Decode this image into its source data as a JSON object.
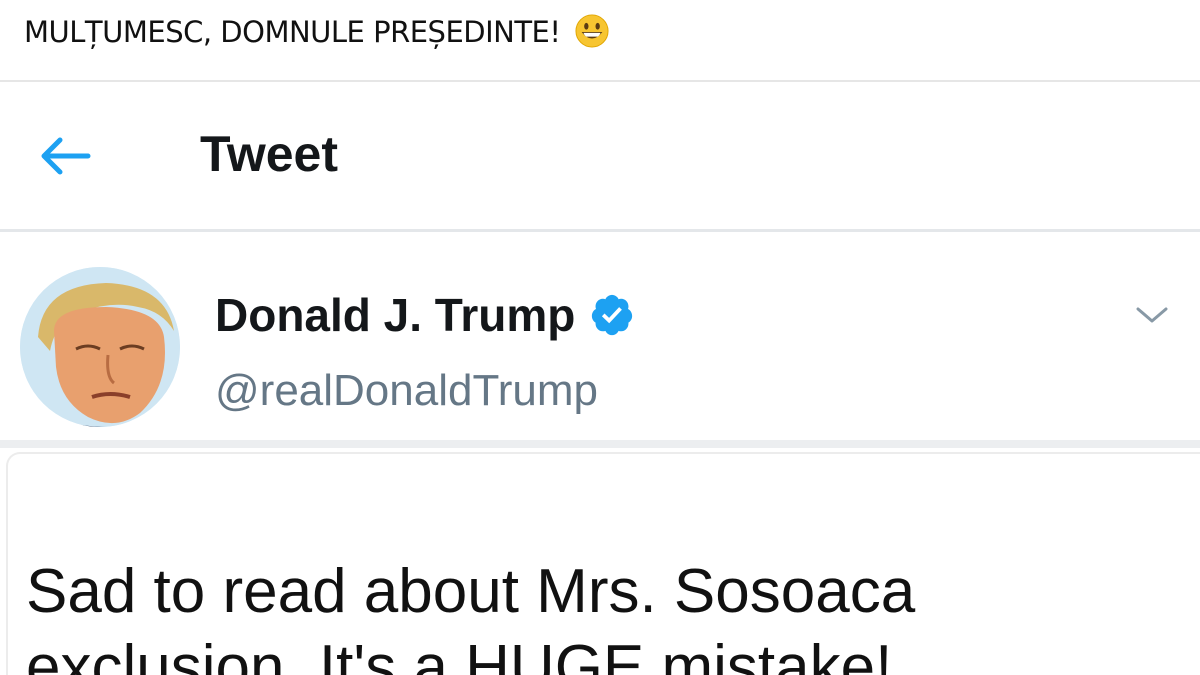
{
  "caption": {
    "text": "MULȚUMESC, DOMNULE PREȘEDINTE!",
    "emoji_icon": "grinning-face-emoji"
  },
  "header": {
    "back_icon": "arrow-left-icon",
    "title": "Tweet"
  },
  "author": {
    "display_name": "Donald J. Trump",
    "verified_icon": "verified-badge-icon",
    "handle": "@realDonaldTrump",
    "menu_icon": "chevron-down-icon"
  },
  "tweet": {
    "text": "Sad to read about Mrs. Sosoaca exclusion. It's a HUGE mistake!"
  },
  "colors": {
    "accent": "#1da1f2",
    "text_primary": "#14171a",
    "text_secondary": "#657786",
    "divider": "#e4e7ea"
  }
}
